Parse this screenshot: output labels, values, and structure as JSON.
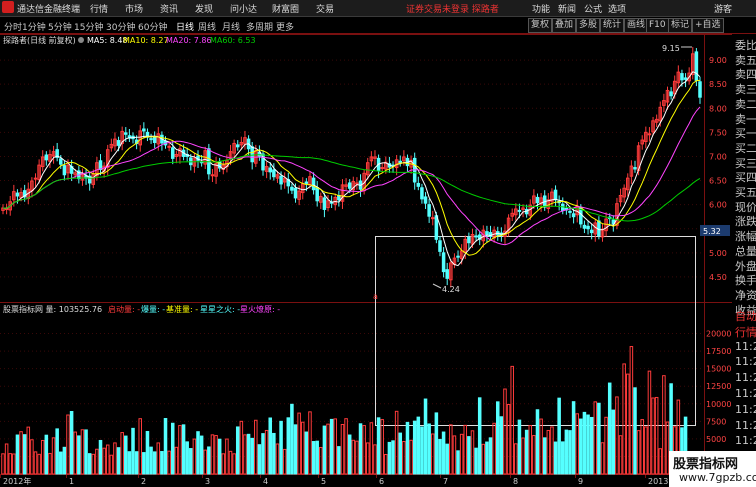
{
  "app": {
    "title": "通达信金融终端"
  },
  "menu": [
    "行情",
    "市场",
    "资讯",
    "发现",
    "问小达",
    "财富圈",
    "交易"
  ],
  "login_status": "证券交易未登录  探路者",
  "window_controls": [
    "功能",
    "新闻",
    "公式",
    "选项"
  ],
  "guest_label": "游客",
  "periods": [
    "分时",
    "1分钟",
    "5分钟",
    "15分钟",
    "30分钟",
    "60分钟",
    "日线",
    "周线",
    "月线",
    "多周期",
    "更多"
  ],
  "active_period": "日线",
  "tool_buttons": [
    "复权",
    "叠加",
    "多股",
    "统计",
    "画线",
    "F10",
    "标记",
    "+自选"
  ],
  "main_legend": {
    "name": "探路者(日线 前复权)",
    "ma5": "MA5: 8.48",
    "ma10": "MA10: 8.27",
    "ma20": "MA20: 7.86",
    "ma60": "MA60: 6.53"
  },
  "vol_legend": {
    "name": "股票指标网 量: 103525.76",
    "items": [
      "启动量: -",
      "爆量: -",
      "基准量: -",
      "星星之火: -",
      "星火燎原: -"
    ]
  },
  "annotations": {
    "high": "9.15",
    "low": "4.24",
    "current": "5.32"
  },
  "price_axis": [
    "9.00",
    "8.50",
    "8.00",
    "7.50",
    "7.00",
    "6.50",
    "6.00",
    "5.50",
    "5.00",
    "4.50"
  ],
  "volume_axis": [
    "20000",
    "17500",
    "15000",
    "12500",
    "10000",
    "7500",
    "5000",
    "2500"
  ],
  "date_axis": [
    "2012年",
    "1",
    "2",
    "3",
    "4",
    "5",
    "6",
    "7",
    "8",
    "9",
    "2013"
  ],
  "right_panel": {
    "items": [
      "委比",
      "卖五",
      "卖四",
      "卖三",
      "卖二",
      "卖一",
      "买一",
      "买二",
      "买三",
      "买四",
      "买五",
      "现价",
      "涨跌",
      "涨幅",
      "总量",
      "外盘",
      "换手",
      "净资",
      "收益",
      "自动",
      "行情",
      "11:25",
      "11:25",
      "11:25",
      "11:25",
      "11:25",
      "11:25",
      "11:25",
      "11:25",
      "11:25"
    ]
  },
  "watermark": {
    "line1": "股票指标网",
    "line2": "www.7gpzb.com"
  },
  "colors": {
    "up": "#ff3b3b",
    "down": "#55ffff",
    "ma5": "#ffffff",
    "ma10": "#ffff00",
    "ma20": "#ff44ff",
    "ma60": "#00cc00",
    "grid": "#7a1010",
    "accent": "#e33"
  },
  "chart_data": {
    "type": "candlestick",
    "price_ylim": [
      4.0,
      9.5
    ],
    "volume_ylim": [
      0,
      22500
    ],
    "prices": [
      5.93,
      5.92,
      6.06,
      6.27,
      6.18,
      6.25,
      6.16,
      6.32,
      6.49,
      6.55,
      6.82,
      6.99,
      6.93,
      7.04,
      7.1,
      6.98,
      6.84,
      6.62,
      6.82,
      6.65,
      6.66,
      6.54,
      6.63,
      6.55,
      6.45,
      6.63,
      6.87,
      6.73,
      6.8,
      7.14,
      7.25,
      7.36,
      7.23,
      7.52,
      7.46,
      7.38,
      7.37,
      7.27,
      7.53,
      7.53,
      7.4,
      7.36,
      7.29,
      7.47,
      7.28,
      7.24,
      7.21,
      6.96,
      7.04,
      7.16,
      7.0,
      7.0,
      6.83,
      6.97,
      6.92,
      6.87,
      7.12,
      6.64,
      6.62,
      6.85,
      6.76,
      6.82,
      6.92,
      7.1,
      7.27,
      7.2,
      7.29,
      7.39,
      7.16,
      6.89,
      7.12,
      7.01,
      6.72,
      6.79,
      6.68,
      6.58,
      6.62,
      6.43,
      6.55,
      6.39,
      6.3,
      6.14,
      6.28,
      6.43,
      6.44,
      6.58,
      6.31,
      6.08,
      6.17,
      5.9,
      6.08,
      6.03,
      6.15,
      6.1,
      6.41,
      6.41,
      6.34,
      6.48,
      6.45,
      6.32,
      6.65,
      6.87,
      6.99,
      6.99,
      6.71,
      6.77,
      6.88,
      6.78,
      6.8,
      6.93,
      6.87,
      6.99,
      6.81,
      6.92,
      6.47,
      6.38,
      6.12,
      6.03,
      5.76,
      5.73,
      5.28,
      5.03,
      4.61,
      4.47,
      4.79,
      4.89,
      4.91,
      5.04,
      5.28,
      5.21,
      5.38,
      5.33,
      5.28,
      5.47,
      5.38,
      5.34,
      5.47,
      5.37,
      5.37,
      5.45,
      5.72,
      5.82,
      5.91,
      5.86,
      5.93,
      5.81,
      5.99,
      6.18,
      6.04,
      6.14,
      5.95,
      6.1,
      6.26,
      6.1,
      6.04,
      5.88,
      5.89,
      5.84,
      5.75,
      5.96,
      5.6,
      5.51,
      5.5,
      5.42,
      5.62,
      5.36,
      5.49,
      5.7,
      5.71,
      5.6,
      6.02,
      6.19,
      6.34,
      6.55,
      6.8,
      6.74,
      7.22,
      7.34,
      7.5,
      7.47,
      7.74,
      7.77,
      8.02,
      8.16,
      8.37,
      8.26,
      8.56,
      8.75,
      8.59,
      8.6,
      8.73,
      9.13,
      8.58,
      8.23
    ],
    "volumes": [
      2875,
      4275,
      2900,
      2850,
      5550,
      6025,
      5600,
      6675,
      4875,
      3150,
      2800,
      4775,
      5525,
      2925,
      5150,
      6425,
      3125,
      3800,
      8400,
      8900,
      5975,
      5425,
      6300,
      6275,
      2900,
      2800,
      3525,
      4775,
      3675,
      4125,
      2675,
      4425,
      3750,
      5900,
      5400,
      3175,
      6500,
      3175,
      7875,
      3050,
      6050,
      3825,
      3150,
      4425,
      3200,
      7900,
      3250,
      7225,
      3800,
      6900,
      7000,
      4575,
      3625,
      4975,
      6025,
      5400,
      3400,
      3850,
      5575,
      5475,
      4950,
      2875,
      4975,
      3225,
      2875,
      6700,
      7500,
      5575,
      5650,
      5075,
      7650,
      4175,
      5750,
      6200,
      7975,
      5775,
      4275,
      7500,
      3500,
      8000,
      9925,
      7000,
      8675,
      7375,
      5975,
      8850,
      4625,
      4675,
      3775,
      6825,
      7100,
      7775,
      7850,
      3900,
      7050,
      7875,
      5550,
      4800,
      4675,
      7150,
      6900,
      4425,
      7300,
      4150,
      8000,
      7750,
      2775,
      4500,
      4725,
      8925,
      5825,
      4625,
      7350,
      4800,
      7525,
      8100,
      6700,
      10675,
      7125,
      5700,
      8700,
      4925,
      5975,
      4250,
      7000,
      5425,
      3300,
      5650,
      6925,
      5325,
      6150,
      3675,
      10850,
      4225,
      4550,
      5150,
      7225,
      10275,
      8150,
      12100,
      9900,
      15325,
      4300,
      7675,
      5125,
      6225,
      6900,
      5475,
      9150,
      7825,
      5150,
      6200,
      6700,
      4550,
      10800,
      4575,
      6250,
      6175,
      10300,
      8575,
      7825,
      8775,
      8400,
      8050,
      10275,
      10075,
      4450,
      8075,
      12950,
      9100,
      10975,
      5450,
      15675,
      14225,
      18150,
      12275,
      6175,
      7750,
      6700,
      14650,
      10825,
      10900,
      3600,
      14000,
      7400,
      12850,
      6725,
      10525,
      6575,
      8100
    ]
  }
}
